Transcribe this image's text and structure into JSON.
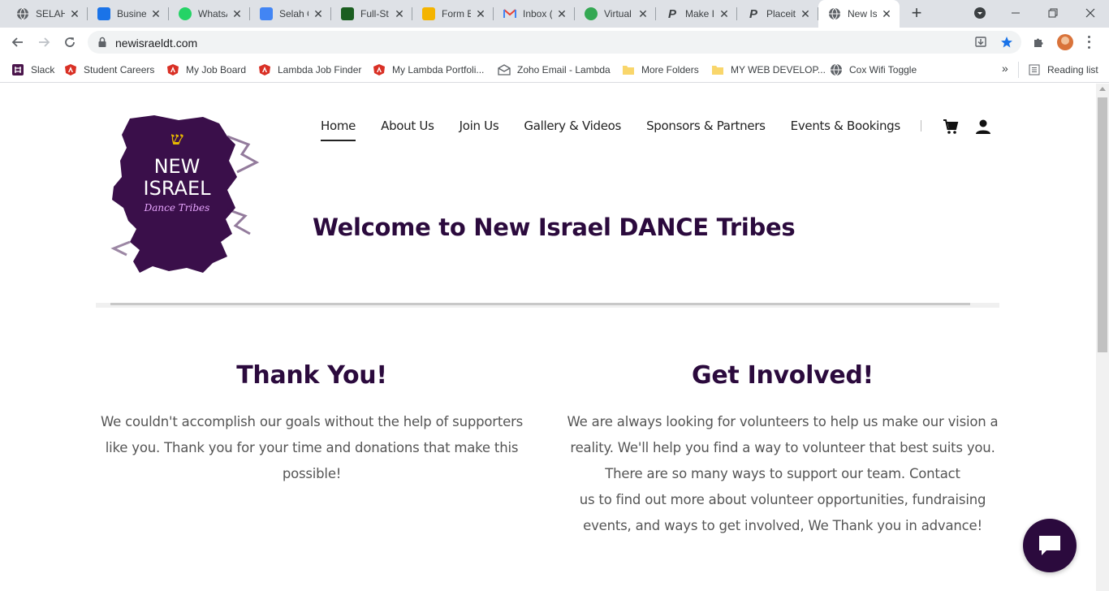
{
  "browser": {
    "tabs": [
      {
        "title": "SELAH",
        "icon": "globe-icon",
        "color": "#5f6368"
      },
      {
        "title": "Busine",
        "icon": "vimeo-icon",
        "color": "#1a73e8"
      },
      {
        "title": "WhatsA",
        "icon": "whatsapp-icon",
        "color": "#25d366"
      },
      {
        "title": "Selah C",
        "icon": "google-docs-icon",
        "color": "#4285f4"
      },
      {
        "title": "Full-St",
        "icon": "codesignal-icon",
        "color": "#1b5e20"
      },
      {
        "title": "Form B",
        "icon": "form-builder-icon",
        "color": "#f4b400"
      },
      {
        "title": "Inbox (",
        "icon": "gmail-icon",
        "color": "#ea4335"
      },
      {
        "title": "Virtual",
        "icon": "zoom-mic-icon",
        "color": "#34a853"
      },
      {
        "title": "Make I",
        "icon": "placeit-icon",
        "color": "#3c4043"
      },
      {
        "title": "Placeit",
        "icon": "placeit-icon",
        "color": "#3c4043"
      },
      {
        "title": "New Is",
        "icon": "globe-icon",
        "color": "#5f6368",
        "active": true
      }
    ],
    "new_tab_symbol": "+",
    "url": "newisraeldt.com",
    "bookmarks": [
      {
        "label": "Slack",
        "icon": "slack-icon"
      },
      {
        "label": "Student Careers",
        "icon": "lambda-icon"
      },
      {
        "label": "My Job Board",
        "icon": "lambda-icon"
      },
      {
        "label": "Lambda Job Finder",
        "icon": "lambda-icon"
      },
      {
        "label": "My Lambda Portfoli...",
        "icon": "lambda-icon"
      },
      {
        "label": "Zoho Email - Lambda",
        "icon": "zoho-icon"
      },
      {
        "label": "More Folders",
        "icon": "folder-icon"
      },
      {
        "label": "MY WEB DEVELOP...",
        "icon": "folder-icon"
      },
      {
        "label": "Cox Wifi Toggle",
        "icon": "globe-icon"
      }
    ],
    "overflow_symbol": "»",
    "reading_list_label": "Reading list"
  },
  "site": {
    "logo": {
      "hebrew_letter": "ש",
      "line1": "NEW",
      "line2": "ISRAEL",
      "script": "Dance Tribes"
    },
    "nav": [
      {
        "label": "Home",
        "active": true
      },
      {
        "label": "About Us"
      },
      {
        "label": "Join Us"
      },
      {
        "label": "Gallery & Videos"
      },
      {
        "label": "Sponsors & Partners"
      },
      {
        "label": "Events & Bookings"
      }
    ],
    "hero_title": "Welcome to New Israel DANCE Tribes",
    "thank_you": {
      "heading": "Thank You!",
      "lines": [
        "We couldn't accomplish our goals without the help of supporters",
        "like you. Thank you for your time and donations that make this",
        "possible!"
      ]
    },
    "get_involved": {
      "heading": "Get Involved!",
      "lines": [
        "We are always looking for volunteers to help us make our vision a",
        "reality. We'll help you find a way to volunteer that best suits you.",
        "There are so many ways to support our team. Contact",
        "us to find out more about volunteer opportunities, fundraising",
        "events, and ways to get involved, We Thank you in advance!"
      ]
    },
    "colors": {
      "brand_purple": "#2b0a3d",
      "body_text": "#555555"
    }
  }
}
